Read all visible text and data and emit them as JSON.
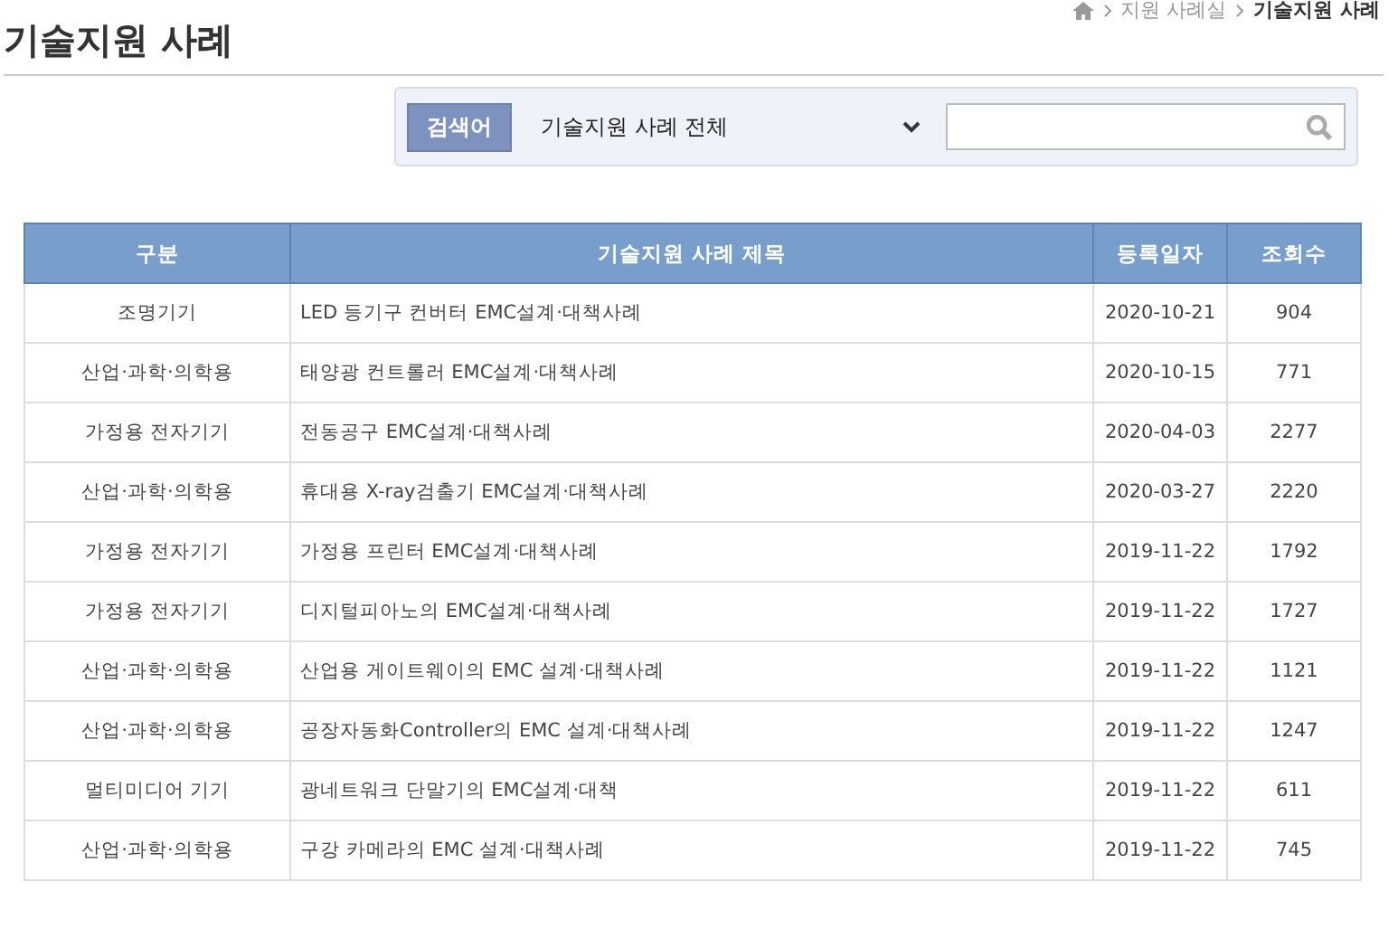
{
  "breadcrumb": [
    "지원 사례실",
    "기술지원 사례"
  ],
  "page_title": "기술지원 사례",
  "search": {
    "label": "검색어",
    "category": "기술지원 사례 전체"
  },
  "table": {
    "columns": [
      "구분",
      "기술지원 사례 제목",
      "등록일자",
      "조회수"
    ],
    "rows": [
      [
        "조명기기",
        "LED 등기구 컨버터 EMC설계·대책사례",
        "2020-10-21",
        "904"
      ],
      [
        "산업·과학·의학용",
        "태양광 컨트롤러 EMC설계·대책사례",
        "2020-10-15",
        "771"
      ],
      [
        "가정용 전자기기",
        "전동공구 EMC설계·대책사례",
        "2020-04-03",
        "2277"
      ],
      [
        "산업·과학·의학용",
        "휴대용 X-ray검출기 EMC설계·대책사례",
        "2020-03-27",
        "2220"
      ],
      [
        "가정용 전자기기",
        "가정용 프린터 EMC설계·대책사례",
        "2019-11-22",
        "1792"
      ],
      [
        "가정용 전자기기",
        "디지털피아노의 EMC설계·대책사례",
        "2019-11-22",
        "1727"
      ],
      [
        "산업·과학·의학용",
        "산업용 게이트웨이의 EMC 설계·대책사례",
        "2019-11-22",
        "1121"
      ],
      [
        "산업·과학·의학용",
        "공장자동화Controller의 EMC 설계·대책사례",
        "2019-11-22",
        "1247"
      ],
      [
        "멀티미디어 기기",
        "광네트워크 단말기의 EMC설계·대책",
        "2019-11-22",
        "611"
      ],
      [
        "산업·과학·의학용",
        "구강 카메라의 EMC 설계·대책사례",
        "2019-11-22",
        "745"
      ]
    ]
  }
}
